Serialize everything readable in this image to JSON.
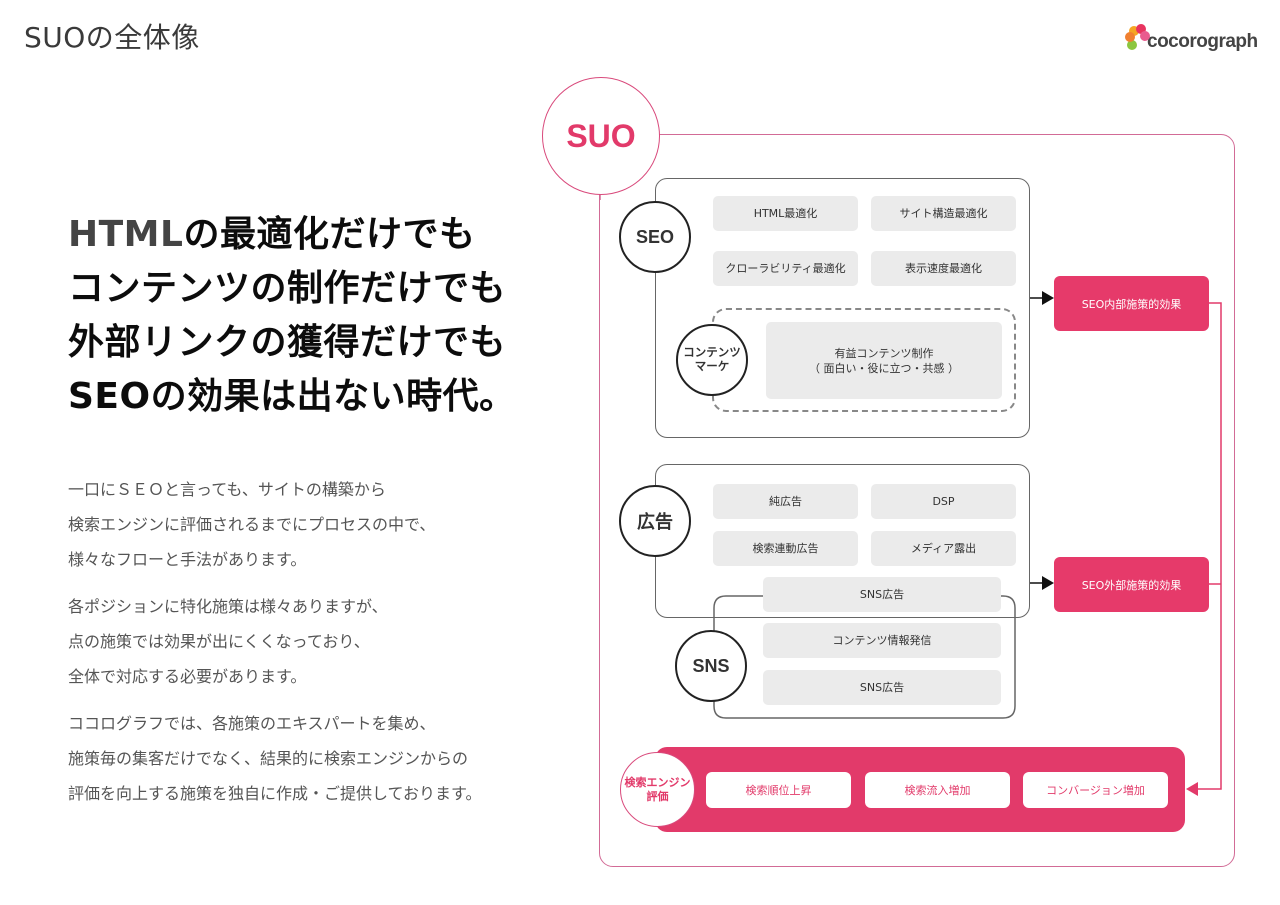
{
  "page": {
    "title": "SUOの全体像",
    "logo_text": "cocorograph",
    "logo_colors": [
      "#f5a623",
      "#e8345f",
      "#e95b8e",
      "#8cc63f",
      "#f08030"
    ]
  },
  "left": {
    "headline_highlight": "HTML",
    "headline_lines": [
      "の最適化だけでも",
      "コンテンツの制作だけでも",
      "外部リンクの獲得だけでも",
      "SEOの効果は出ない時代。"
    ],
    "paragraphs": [
      [
        "一口にＳＥＯと言っても、サイトの構築から",
        "検索エンジンに評価されるまでにプロセスの中で、",
        "様々なフローと手法があります。"
      ],
      [
        "各ポジションに特化施策は様々ありますが、",
        "点の施策では効果が出にくくなっており、",
        "全体で対応する必要があります。"
      ],
      [
        "ココログラフでは、各施策のエキスパートを集め、",
        "施策毎の集客だけでなく、結果的に検索エンジンからの",
        "評価を向上する施策を独自に作成・ご提供しております。"
      ]
    ]
  },
  "diagram": {
    "root_label": "SUO",
    "colors": {
      "accent": "#e23a6a",
      "frame": "#d26b96",
      "chip": "#ebebeb",
      "outline": "#666666"
    },
    "seo": {
      "label": "SEO",
      "items": [
        "HTML最適化",
        "サイト構造最適化",
        "クローラビリティ最適化",
        "表示速度最適化"
      ],
      "content_marketing": {
        "label_line1": "コンテンツ",
        "label_line2": "マーケ",
        "item_line1": "有益コンテンツ制作",
        "item_line2": "（ 面白い・役に立つ・共感 ）"
      },
      "effect": "SEO内部施策的効果"
    },
    "ads": {
      "label": "広告",
      "items": [
        "純広告",
        "DSP",
        "検索連動広告",
        "メディア露出"
      ],
      "shared_item": "SNS広告",
      "effect": "SEO外部施策的効果"
    },
    "sns": {
      "label": "SNS",
      "items": [
        "コンテンツ情報発信",
        "SNS広告"
      ]
    },
    "evaluation": {
      "label_line1": "検索エンジン",
      "label_line2": "評価",
      "items": [
        "検索順位上昇",
        "検索流入増加",
        "コンバージョン増加"
      ]
    }
  }
}
